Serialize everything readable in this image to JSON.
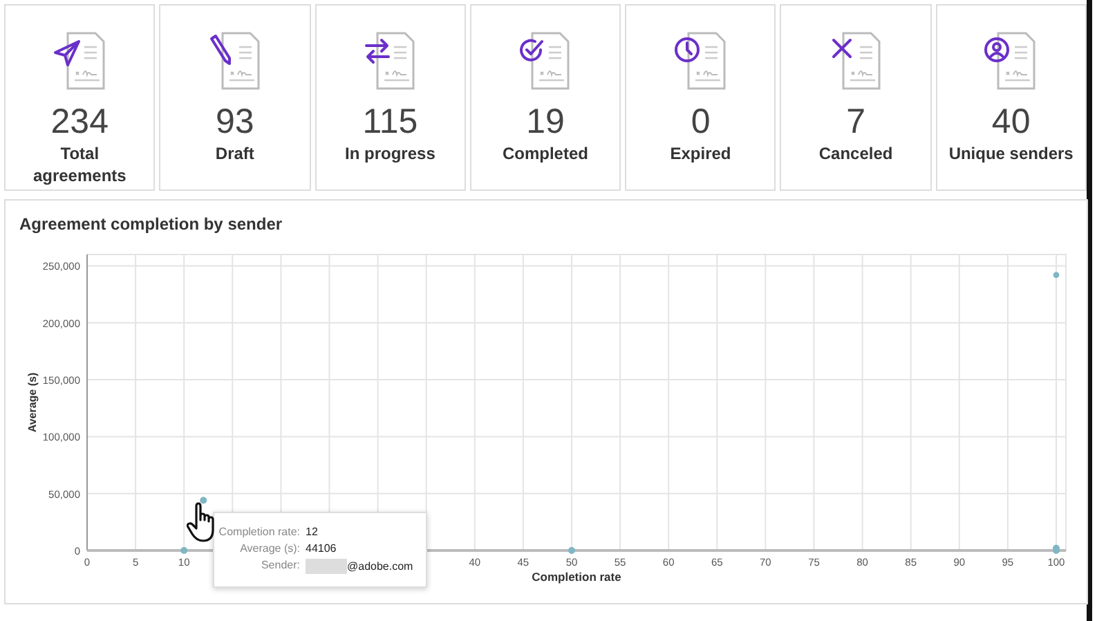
{
  "cards": [
    {
      "kind": "send",
      "value": "234",
      "label": "Total agreements"
    },
    {
      "kind": "pen",
      "value": "93",
      "label": "Draft"
    },
    {
      "kind": "arrows",
      "value": "115",
      "label": "In progress"
    },
    {
      "kind": "check",
      "value": "19",
      "label": "Completed"
    },
    {
      "kind": "clock",
      "value": "0",
      "label": "Expired"
    },
    {
      "kind": "cross",
      "value": "7",
      "label": "Canceled"
    },
    {
      "kind": "user",
      "value": "40",
      "label": "Unique senders"
    }
  ],
  "chart_panel": {
    "title": "Agreement completion by sender",
    "chart_data": {
      "type": "scatter",
      "xlabel": "Completion rate",
      "ylabel": "Average (s)",
      "grid": true,
      "xlim": [
        0,
        101
      ],
      "ylim": [
        0,
        260000
      ],
      "xticks": [
        0,
        5,
        10,
        40,
        45,
        50,
        55,
        60,
        65,
        70,
        75,
        80,
        85,
        90,
        95,
        100
      ],
      "yticks": [
        {
          "value": 0,
          "label": "0"
        },
        {
          "value": 50000,
          "label": "50,000"
        },
        {
          "value": 100000,
          "label": "100,000"
        },
        {
          "value": 150000,
          "label": "150,000"
        },
        {
          "value": 200000,
          "label": "200,000"
        },
        {
          "value": 250000,
          "label": "250,000"
        }
      ],
      "series": [
        {
          "color": "#7fb6c4",
          "x": [
            10,
            12,
            50,
            100,
            100,
            100
          ],
          "values": [
            0,
            44000,
            0,
            242000,
            0,
            2000
          ]
        }
      ]
    },
    "tooltip": {
      "rows": [
        {
          "label": "Completion rate:",
          "value": "12"
        },
        {
          "label": "Average (s):",
          "value": "44106"
        },
        {
          "label": "Sender:",
          "value": "@adobe.com",
          "redacted": true
        }
      ]
    }
  }
}
